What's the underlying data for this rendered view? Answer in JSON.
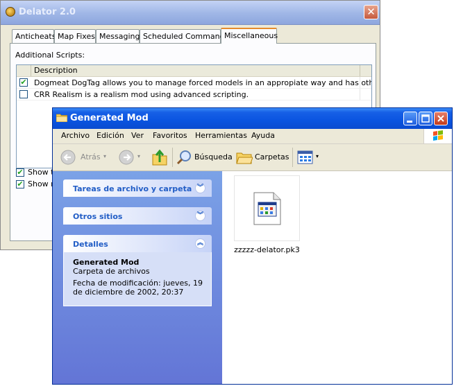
{
  "delator": {
    "title": "Delator 2.0",
    "close_glyph": "✕",
    "tabs": [
      {
        "label": "Anticheats",
        "active": false
      },
      {
        "label": "Map Fixes",
        "active": false
      },
      {
        "label": "Messaging",
        "active": false
      },
      {
        "label": "Scheduled Commands",
        "active": false
      },
      {
        "label": "Miscellaneous",
        "active": true
      }
    ],
    "section_label": "Additional Scripts:",
    "list_header": "Description",
    "scripts": [
      {
        "checked": true,
        "text": "Dogmeat DogTag allows you to manage forced models in an appropiate way and has other good..."
      },
      {
        "checked": false,
        "text": "CRR Realism is a realism mod using advanced scripting."
      }
    ],
    "options": [
      {
        "checked": true,
        "text": "Show ti"
      },
      {
        "checked": true,
        "text": "Show n"
      }
    ],
    "check_glyph": "✔"
  },
  "explorer": {
    "title": "Generated Mod",
    "menu": [
      "Archivo",
      "Edición",
      "Ver",
      "Favoritos",
      "Herramientas",
      "Ayuda"
    ],
    "toolbar": {
      "back": "Atrás",
      "search": "Búsqueda",
      "folders": "Carpetas"
    },
    "tasks": [
      {
        "label": "Tareas de archivo y carpeta",
        "chevron": "︾"
      },
      {
        "label": "Otros sitios",
        "chevron": "︾"
      },
      {
        "label": "Detalles",
        "chevron": "︽"
      }
    ],
    "details": {
      "name": "Generated Mod",
      "type": "Carpeta de archivos",
      "modified": "Fecha de modificación: jueves, 19 de diciembre de 2002, 20:37"
    },
    "file": {
      "name": "zzzzz-delator.pk3"
    }
  },
  "colors": {
    "xp_blue": "#0a54e0",
    "task_link": "#215dc6",
    "panel_bg": "#ece9d8",
    "tab_accent": "#e68b2c"
  }
}
